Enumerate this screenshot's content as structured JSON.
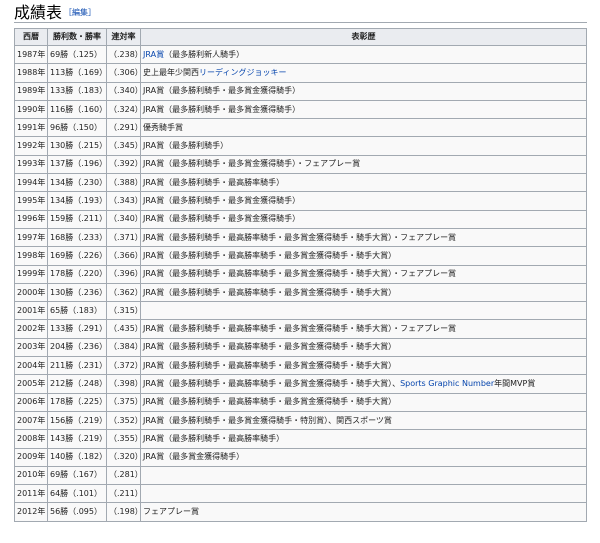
{
  "heading": {
    "title": "成績表",
    "edit_bracket_open": "［",
    "edit_label": "編集",
    "edit_bracket_close": "］"
  },
  "table": {
    "headers": [
      "西暦",
      "勝利数・勝率",
      "連対率",
      "表彰歴"
    ],
    "rows": [
      {
        "year": "1987年",
        "wins": "69勝（.125）",
        "rate": "（.238）",
        "award": [
          {
            "text": "JRA賞",
            "link": true
          },
          {
            "text": "（最多勝利新人騎手）"
          }
        ]
      },
      {
        "year": "1988年",
        "wins": "113勝（.169）",
        "rate": "（.306）",
        "award": [
          {
            "text": "史上最年少関西"
          },
          {
            "text": "リーディングジョッキー",
            "link": true
          }
        ]
      },
      {
        "year": "1989年",
        "wins": "133勝（.183）",
        "rate": "（.340）",
        "award": [
          {
            "text": "JRA賞（最多勝利騎手・最多賞金獲得騎手）"
          }
        ]
      },
      {
        "year": "1990年",
        "wins": "116勝（.160）",
        "rate": "（.324）",
        "award": [
          {
            "text": "JRA賞（最多勝利騎手・最多賞金獲得騎手）"
          }
        ]
      },
      {
        "year": "1991年",
        "wins": "96勝（.150）",
        "rate": "（.291）",
        "award": [
          {
            "text": "優秀騎手賞"
          }
        ]
      },
      {
        "year": "1992年",
        "wins": "130勝（.215）",
        "rate": "（.345）",
        "award": [
          {
            "text": "JRA賞（最多勝利騎手）"
          }
        ]
      },
      {
        "year": "1993年",
        "wins": "137勝（.196）",
        "rate": "（.392）",
        "award": [
          {
            "text": "JRA賞（最多勝利騎手・最多賞金獲得騎手）・フェアプレー賞"
          }
        ]
      },
      {
        "year": "1994年",
        "wins": "134勝（.230）",
        "rate": "（.388）",
        "award": [
          {
            "text": "JRA賞（最多勝利騎手・最高勝率騎手）"
          }
        ]
      },
      {
        "year": "1995年",
        "wins": "134勝（.193）",
        "rate": "（.343）",
        "award": [
          {
            "text": "JRA賞（最多勝利騎手・最多賞金獲得騎手）"
          }
        ]
      },
      {
        "year": "1996年",
        "wins": "159勝（.211）",
        "rate": "（.340）",
        "award": [
          {
            "text": "JRA賞（最多勝利騎手・最多賞金獲得騎手）"
          }
        ]
      },
      {
        "year": "1997年",
        "wins": "168勝（.233）",
        "rate": "（.371）",
        "award": [
          {
            "text": "JRA賞（最多勝利騎手・最高勝率騎手・最多賞金獲得騎手・騎手大賞）・フェアプレー賞"
          }
        ]
      },
      {
        "year": "1998年",
        "wins": "169勝（.226）",
        "rate": "（.366）",
        "award": [
          {
            "text": "JRA賞（最多勝利騎手・最高勝率騎手・最多賞金獲得騎手・騎手大賞）"
          }
        ]
      },
      {
        "year": "1999年",
        "wins": "178勝（.220）",
        "rate": "（.396）",
        "award": [
          {
            "text": "JRA賞（最多勝利騎手・最高勝率騎手・最多賞金獲得騎手・騎手大賞）・フェアプレー賞"
          }
        ]
      },
      {
        "year": "2000年",
        "wins": "130勝（.236）",
        "rate": "（.362）",
        "award": [
          {
            "text": "JRA賞（最多勝利騎手・最高勝率騎手・最多賞金獲得騎手・騎手大賞）"
          }
        ]
      },
      {
        "year": "2001年",
        "wins": "65勝（.183）",
        "rate": "（.315）",
        "award": []
      },
      {
        "year": "2002年",
        "wins": "133勝（.291）",
        "rate": "（.435）",
        "award": [
          {
            "text": "JRA賞（最多勝利騎手・最高勝率騎手・最多賞金獲得騎手・騎手大賞）・フェアプレー賞"
          }
        ]
      },
      {
        "year": "2003年",
        "wins": "204勝（.236）",
        "rate": "（.384）",
        "award": [
          {
            "text": "JRA賞（最多勝利騎手・最高勝率騎手・最多賞金獲得騎手・騎手大賞）"
          }
        ]
      },
      {
        "year": "2004年",
        "wins": "211勝（.231）",
        "rate": "（.372）",
        "award": [
          {
            "text": "JRA賞（最多勝利騎手・最高勝率騎手・最多賞金獲得騎手・騎手大賞）"
          }
        ]
      },
      {
        "year": "2005年",
        "wins": "212勝（.248）",
        "rate": "（.398）",
        "award": [
          {
            "text": "JRA賞（最多勝利騎手・最高勝率騎手・最多賞金獲得騎手・騎手大賞）、"
          },
          {
            "text": "Sports Graphic Number",
            "link": true
          },
          {
            "text": "年間MVP賞"
          }
        ]
      },
      {
        "year": "2006年",
        "wins": "178勝（.225）",
        "rate": "（.375）",
        "award": [
          {
            "text": "JRA賞（最多勝利騎手・最高勝率騎手・最多賞金獲得騎手・騎手大賞）"
          }
        ]
      },
      {
        "year": "2007年",
        "wins": "156勝（.219）",
        "rate": "（.352）",
        "award": [
          {
            "text": "JRA賞（最多勝利騎手・最多賞金獲得騎手・特別賞）、関西スポーツ賞"
          }
        ]
      },
      {
        "year": "2008年",
        "wins": "143勝（.219）",
        "rate": "（.355）",
        "award": [
          {
            "text": "JRA賞（最多勝利騎手・最高勝率騎手）"
          }
        ]
      },
      {
        "year": "2009年",
        "wins": "140勝（.182）",
        "rate": "（.320）",
        "award": [
          {
            "text": "JRA賞（最多賞金獲得騎手）"
          }
        ]
      },
      {
        "year": "2010年",
        "wins": "69勝（.167）",
        "rate": "（.281）",
        "award": []
      },
      {
        "year": "2011年",
        "wins": "64勝（.101）",
        "rate": "（.211）",
        "award": []
      },
      {
        "year": "2012年",
        "wins": "56勝（.095）",
        "rate": "（.198）",
        "award": [
          {
            "text": "フェアプレー賞"
          }
        ]
      }
    ]
  }
}
